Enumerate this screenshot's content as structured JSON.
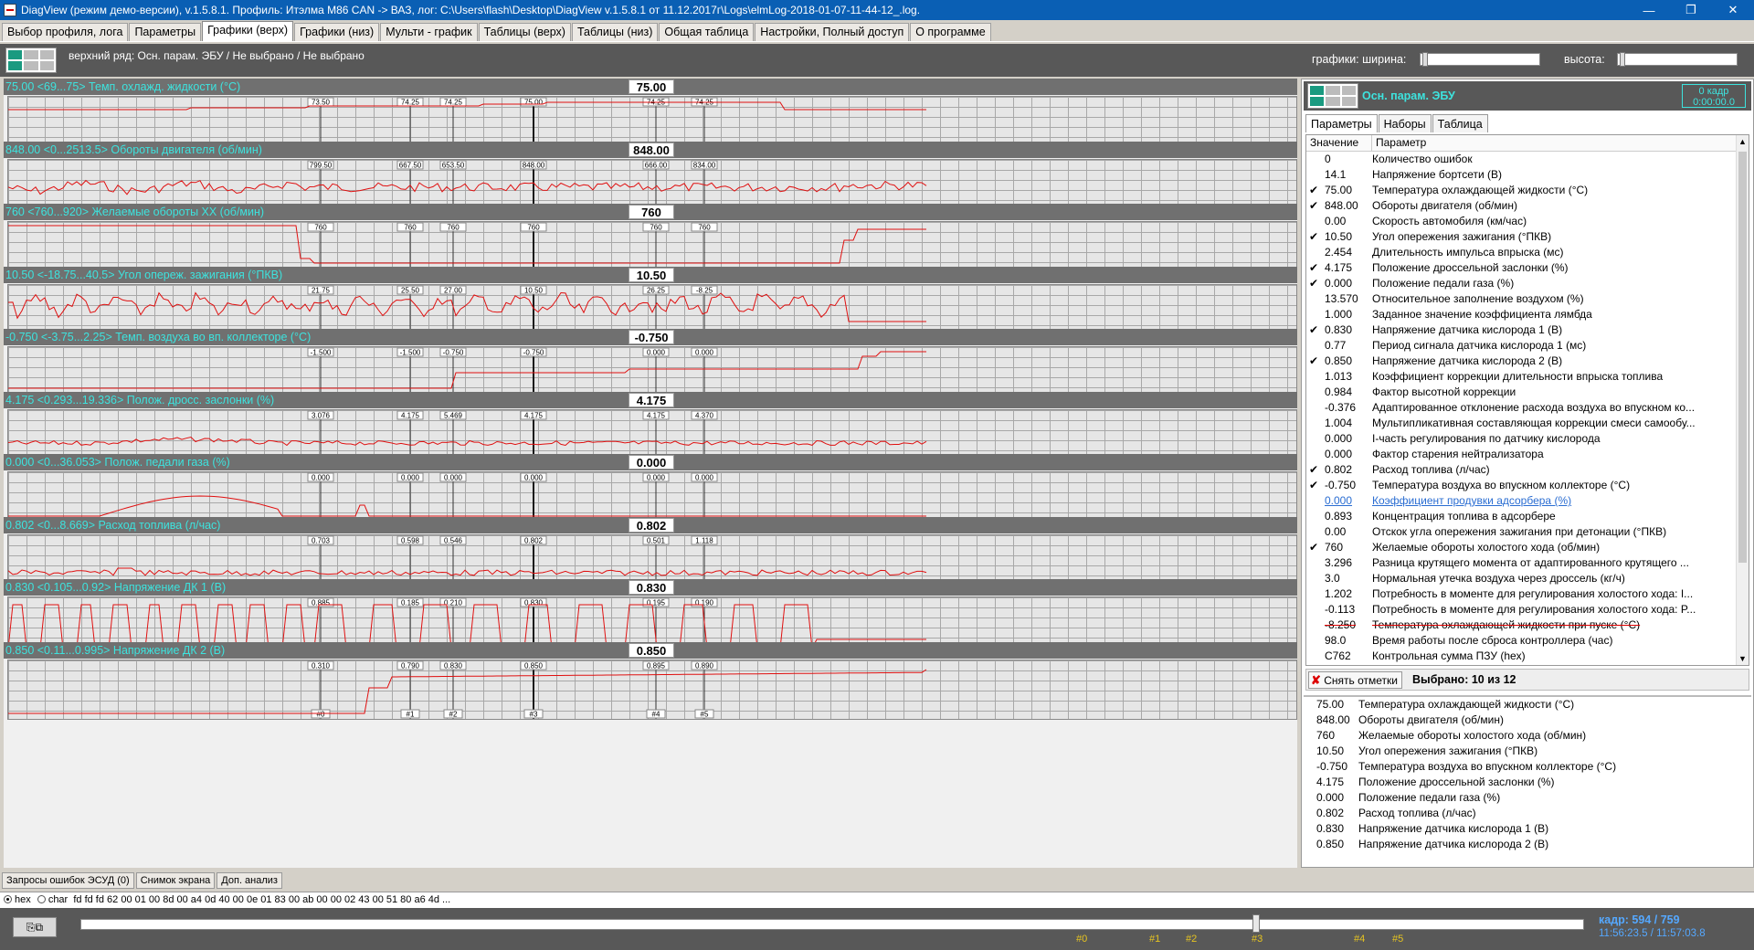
{
  "window": {
    "title": "DiagView (режим демо-версии), v.1.5.8.1. Профиль: Итэлма M86 CAN -> ВАЗ,  лог: C:\\Users\\flash\\Desktop\\DiagView v.1.5.8.1 от 11.12.2017г\\Logs\\elmLog-2018-01-07-11-44-12_.log.",
    "minimize": "—",
    "restore": "❐",
    "close": "✕"
  },
  "menu_tabs": [
    "Выбор профиля, лога",
    "Параметры",
    "Графики (верх)",
    "Графики (низ)",
    "Мульти - график",
    "Таблицы (верх)",
    "Таблицы (низ)",
    "Общая таблица",
    "Настройки, Полный доступ",
    "О программе"
  ],
  "active_tab": "Графики (верх)",
  "plot_header": "верхний ряд: Осн. парам. ЭБУ / Не выбрано / Не выбрано",
  "graph_controls": {
    "graphs_label": "графики:  ширина:",
    "height_label": "высота:"
  },
  "markers": [
    "#0",
    "#1",
    "#2",
    "#3",
    "#4",
    "#5"
  ],
  "colors": {
    "trace": "#e01010",
    "title_text": "#3de3de",
    "accent_bar": "#585858",
    "marker_text": "#e6c420"
  },
  "channels": [
    {
      "title": "75.00   <69...75>  Темп. охлажд. жидкости (°C)",
      "value": "75.00",
      "labels": [
        "73.50",
        "74.25",
        "74.25",
        "75.00",
        "74.25",
        "74.25"
      ]
    },
    {
      "title": "848.00   <0...2513.5>  Обороты двигателя (об/мин)",
      "value": "848.00",
      "labels": [
        "799.50",
        "667.50",
        "653.50",
        "848.00",
        "666.00",
        "834.00"
      ]
    },
    {
      "title": "760   <760...920>  Желаемые обороты ХХ (об/мин)",
      "value": "760",
      "labels": [
        "760",
        "760",
        "760",
        "760",
        "760",
        "760"
      ]
    },
    {
      "title": "10.50   <-18.75...40.5>  Угол опереж. зажигания (°ПКВ)",
      "value": "10.50",
      "labels": [
        "21.75",
        "25.50",
        "27.00",
        "10.50",
        "26.25",
        "-8.25"
      ]
    },
    {
      "title": "-0.750   <-3.75...2.25>  Темп. воздуха во вп. коллекторе (°C)",
      "value": "-0.750",
      "labels": [
        "-1.500",
        "-1.500",
        "-0.750",
        "-0.750",
        "0.000",
        "0.000"
      ]
    },
    {
      "title": "4.175   <0.293...19.336>  Полож. дросс. заслонки (%)",
      "value": "4.175",
      "labels": [
        "3.076",
        "4.175",
        "5.469",
        "4.175",
        "4.175",
        "4.370"
      ]
    },
    {
      "title": "0.000   <0...36.053>  Полож. педали газа (%)",
      "value": "0.000",
      "labels": [
        "0.000",
        "0.000",
        "0.000",
        "0.000",
        "0.000",
        "0.000"
      ]
    },
    {
      "title": "0.802   <0...8.669>  Расход топлива (л/час)",
      "value": "0.802",
      "labels": [
        "0.703",
        "0.598",
        "0.546",
        "0.802",
        "0.501",
        "1.118"
      ]
    },
    {
      "title": "0.830   <0.105...0.92>  Напряжение ДК 1 (В)",
      "value": "0.830",
      "labels": [
        "0.885",
        "0.185",
        "0.210",
        "0.830",
        "0.195",
        "0.190"
      ]
    },
    {
      "title": "0.850   <0.11...0.995>  Напряжение ДК 2 (В)",
      "value": "0.850",
      "labels": [
        "0.310",
        "0.790",
        "0.830",
        "0.850",
        "0.895",
        "0.890"
      ]
    }
  ],
  "right_panel": {
    "group_name": "Осн. парам. ЭБУ",
    "frame_box": {
      "frame": "0 кадр",
      "time": "0:00:00.0"
    },
    "tabs": [
      "Параметры",
      "Наборы",
      "Таблица"
    ],
    "col_value": "Значение",
    "col_param": "Параметр",
    "params": [
      {
        "c": false,
        "v": "0",
        "n": "Количество ошибок"
      },
      {
        "c": false,
        "v": "14.1",
        "n": "Напряжение бортсети (В)"
      },
      {
        "c": true,
        "v": "75.00",
        "n": "Температура охлаждающей жидкости (°C)"
      },
      {
        "c": true,
        "v": "848.00",
        "n": "Обороты двигателя (об/мин)"
      },
      {
        "c": false,
        "v": "0.00",
        "n": "Скорость автомобиля (км/час)"
      },
      {
        "c": true,
        "v": "10.50",
        "n": "Угол опережения зажигания (°ПКВ)"
      },
      {
        "c": false,
        "v": "2.454",
        "n": "Длительность импульса впрыска (мс)"
      },
      {
        "c": true,
        "v": "4.175",
        "n": "Положение дроссельной заслонки (%)"
      },
      {
        "c": true,
        "v": "0.000",
        "n": "Положение педали газа (%)"
      },
      {
        "c": false,
        "v": "13.570",
        "n": "Относительное заполнение воздухом (%)"
      },
      {
        "c": false,
        "v": "1.000",
        "n": "Заданное значение коэффициента лямбда"
      },
      {
        "c": true,
        "v": "0.830",
        "n": "Напряжение датчика кислорода 1 (В)"
      },
      {
        "c": false,
        "v": "0.77",
        "n": "Период сигнала датчика кислорода 1 (мс)"
      },
      {
        "c": true,
        "v": "0.850",
        "n": "Напряжение датчика кислорода 2 (В)"
      },
      {
        "c": false,
        "v": "1.013",
        "n": "Коэффициент коррекции длительности впрыска топлива"
      },
      {
        "c": false,
        "v": "0.984",
        "n": "Фактор высотной коррекции"
      },
      {
        "c": false,
        "v": "-0.376",
        "n": "Адаптированное отклонение расхода воздуха во впускном ко..."
      },
      {
        "c": false,
        "v": "1.004",
        "n": "Мультипликативная составляющая коррекции смеси самообу..."
      },
      {
        "c": false,
        "v": "0.000",
        "n": "I-часть регулирования по датчику кислорода"
      },
      {
        "c": false,
        "v": "0.000",
        "n": "Фактор старения нейтрализатора"
      },
      {
        "c": true,
        "v": "0.802",
        "n": "Расход топлива (л/час)"
      },
      {
        "c": true,
        "v": "-0.750",
        "n": "Температура воздуха во впускном коллекторе (°C)"
      },
      {
        "c": false,
        "v": "0.000",
        "n": "Коэффициент продувки адсорбера (%)",
        "link": true
      },
      {
        "c": false,
        "v": "0.893",
        "n": "Концентрация топлива в адсорбере"
      },
      {
        "c": false,
        "v": "0.00",
        "n": "Отскок угла опережения зажигания при детонации (°ПКВ)"
      },
      {
        "c": true,
        "v": "760",
        "n": "Желаемые обороты холостого хода (об/мин)"
      },
      {
        "c": false,
        "v": "3.296",
        "n": "Разница крутящего момента от адаптированного крутящего ..."
      },
      {
        "c": false,
        "v": "3.0",
        "n": "Нормальная утечка воздуха через дроссель (кг/ч)"
      },
      {
        "c": false,
        "v": "1.202",
        "n": "Потребность в моменте для регулирования холостого хода: I..."
      },
      {
        "c": false,
        "v": "-0.113",
        "n": "Потребность в моменте для регулирования холостого хода: P..."
      },
      {
        "c": false,
        "v": "-8.250",
        "n": "Температура охлаждающей жидкости при пуске (°C)",
        "strike": true
      },
      {
        "c": false,
        "v": "98.0",
        "n": "Время работы после сброса контроллера (час)"
      },
      {
        "c": false,
        "v": "C762",
        "n": "Контрольная сумма ПЗУ (hex)"
      }
    ],
    "clear_button": "Снять отметки",
    "selected_count": "Выбрано: 10 из 12",
    "selected_list": [
      {
        "v": "75.00",
        "n": "Температура охлаждающей жидкости (°C)"
      },
      {
        "v": "848.00",
        "n": "Обороты двигателя (об/мин)"
      },
      {
        "v": "760",
        "n": "Желаемые обороты холостого хода (об/мин)"
      },
      {
        "v": "10.50",
        "n": "Угол опережения зажигания (°ПКВ)"
      },
      {
        "v": "-0.750",
        "n": "Температура воздуха во впускном коллекторе (°C)"
      },
      {
        "v": "4.175",
        "n": "Положение дроссельной заслонки (%)"
      },
      {
        "v": "0.000",
        "n": "Положение педали газа (%)"
      },
      {
        "v": "0.802",
        "n": "Расход топлива (л/час)"
      },
      {
        "v": "0.830",
        "n": "Напряжение датчика кислорода 1 (В)"
      },
      {
        "v": "0.850",
        "n": "Напряжение датчика кислорода 2 (В)"
      }
    ]
  },
  "bottom_tabs": [
    "Запросы ошибок ЭСУД (0)",
    "Снимок экрана",
    "Доп. анализ"
  ],
  "hex": {
    "opt_hex": "hex",
    "opt_char": "char",
    "data": "fd fd fd 62 00 01 00 8d 00 a4 0d 40 00 0e 01 83 00 ab 00 00 02 43 00 51 80 a6 4d ..."
  },
  "nav": {
    "frame": "кадр: 594 / 759",
    "time": "11:56:23.5 / 11:57:03.8",
    "position": 0.782
  }
}
